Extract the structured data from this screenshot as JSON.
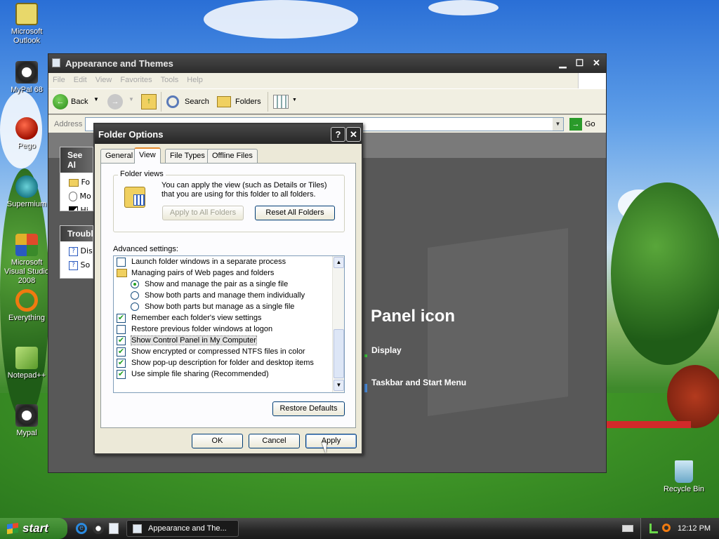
{
  "desktop": {
    "icons": [
      {
        "label": "Microsoft Outlook"
      },
      {
        "label": "MyPal 68"
      },
      {
        "label": "Pego"
      },
      {
        "label": "Supermium"
      },
      {
        "label": "Microsoft Visual Studio 2008"
      },
      {
        "label": "Everything"
      },
      {
        "label": "Notepad++"
      },
      {
        "label": "Mypal"
      },
      {
        "label": "Recycle Bin"
      }
    ]
  },
  "explorer": {
    "title": "Appearance and Themes",
    "menu": [
      "File",
      "Edit",
      "View",
      "Favorites",
      "Tools",
      "Help"
    ],
    "toolbar": {
      "back": "Back",
      "search": "Search",
      "folders": "Folders"
    },
    "address": {
      "label": "Address",
      "go": "Go"
    },
    "see_also": {
      "title": "See Al",
      "items": [
        "Fo",
        "Mo",
        "Hi"
      ]
    },
    "troubleshooters": {
      "title": "Troubl",
      "items": [
        "Dis",
        "So"
      ]
    },
    "panel": {
      "heading": "Panel icon",
      "link1": "Display",
      "link2": "Taskbar and Start Menu"
    }
  },
  "dialog": {
    "title": "Folder Options",
    "help": "?",
    "close": "✕",
    "tabs": [
      "General",
      "View",
      "File Types",
      "Offline Files"
    ],
    "active_tab": "View",
    "folder_views": {
      "legend": "Folder views",
      "description": "You can apply the view (such as Details or Tiles) that you are using for this folder to all folders.",
      "apply_all": "Apply to All Folders",
      "reset_all": "Reset All Folders"
    },
    "advanced_label": "Advanced settings:",
    "settings": [
      {
        "kind": "checkbox",
        "checked": false,
        "label": "Launch folder windows in a separate process"
      },
      {
        "kind": "folder",
        "label": "Managing pairs of Web pages and folders"
      },
      {
        "kind": "radio",
        "checked": true,
        "label": "Show and manage the pair as a single file"
      },
      {
        "kind": "radio",
        "checked": false,
        "label": "Show both parts and manage them individually"
      },
      {
        "kind": "radio",
        "checked": false,
        "label": "Show both parts but manage as a single file"
      },
      {
        "kind": "checkbox",
        "checked": true,
        "label": "Remember each folder's view settings"
      },
      {
        "kind": "checkbox",
        "checked": false,
        "label": "Restore previous folder windows at logon"
      },
      {
        "kind": "checkbox",
        "checked": true,
        "label": "Show Control Panel in My Computer",
        "selected": true
      },
      {
        "kind": "checkbox",
        "checked": true,
        "label": "Show encrypted or compressed NTFS files in color"
      },
      {
        "kind": "checkbox",
        "checked": true,
        "label": "Show pop-up description for folder and desktop items"
      },
      {
        "kind": "checkbox",
        "checked": true,
        "label": "Use simple file sharing (Recommended)"
      }
    ],
    "restore_defaults": "Restore Defaults",
    "ok": "OK",
    "cancel": "Cancel",
    "apply": "Apply"
  },
  "taskbar": {
    "start": "start",
    "task": "Appearance and The...",
    "clock": "12:12 PM"
  },
  "colors": {
    "check": "#21a121",
    "dialog_bg": "#ece9d8",
    "title_dark": "#2c2c2c"
  }
}
